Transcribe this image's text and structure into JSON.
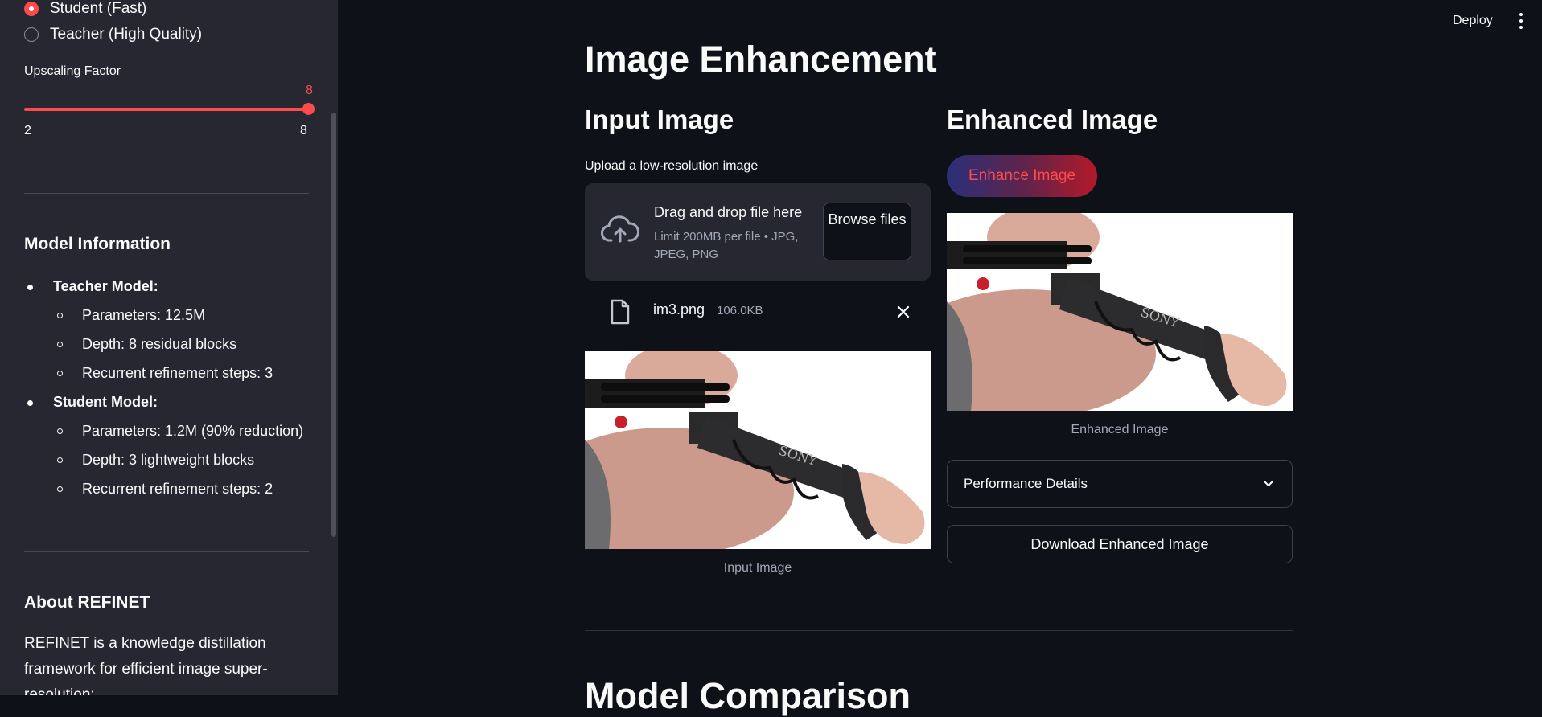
{
  "sidebar": {
    "model_options": [
      "Student (Fast)",
      "Teacher (High Quality)"
    ],
    "selected_model": "Student (Fast)",
    "slider": {
      "label": "Upscaling Factor",
      "value": "8",
      "min": "2",
      "max": "8"
    },
    "model_info": {
      "title": "Model Information",
      "teacher": {
        "label": "Teacher Model:",
        "details": [
          "Parameters: 12.5M",
          "Depth: 8 residual blocks",
          "Recurrent refinement steps: 3"
        ]
      },
      "student": {
        "label": "Student Model:",
        "details": [
          "Parameters: 1.2M (90% reduction)",
          "Depth: 3 lightweight blocks",
          "Recurrent refinement steps: 2"
        ]
      }
    },
    "about": {
      "title": "About REFINET",
      "text": "REFINET is a knowledge distillation framework for efficient image super-resolution:"
    }
  },
  "header": {
    "deploy_label": "Deploy"
  },
  "main": {
    "title": "Image Enhancement",
    "input": {
      "heading": "Input Image",
      "upload_label": "Upload a low-resolution image",
      "dropzone_title": "Drag and drop file here",
      "dropzone_limits": "Limit 200MB per file • JPG, JPEG, PNG",
      "browse_label": "Browse files",
      "file_name": "im3.png",
      "file_size": "106.0KB",
      "caption": "Input Image"
    },
    "output": {
      "heading": "Enhanced Image",
      "enhance_button": "Enhance Image",
      "caption": "Enhanced Image",
      "expander_label": "Performance Details",
      "download_label": "Download Enhanced Image"
    },
    "next_section_heading": "Model Comparison",
    "image_brand_text": "SONY"
  },
  "colors": {
    "accent": "#ff4b4b",
    "background": "#0e1117",
    "sidebar": "#262730"
  }
}
